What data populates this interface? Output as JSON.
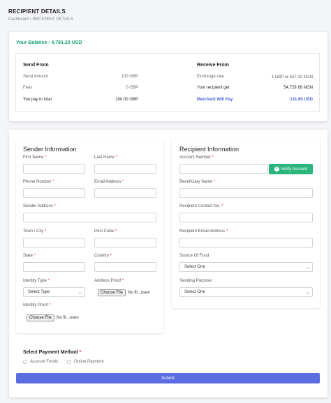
{
  "header": {
    "title": "RECIPIENT DETAILS",
    "breadcrumb": [
      "Dashboard",
      "RECIPIENT DETAILS"
    ],
    "breadcrumb_sep": "›"
  },
  "balance": "Your Balance : 4,791.20 USD",
  "send_from": {
    "title": "Send From",
    "rows": [
      {
        "label": "Send Amount",
        "value": "100 GBP"
      },
      {
        "label": "Fees",
        "value": "0 GBP"
      },
      {
        "label": "You pay in total",
        "value": "100.00 GBP"
      }
    ]
  },
  "receive_from": {
    "title": "Receive From",
    "rows": [
      {
        "label": "Exchange rate",
        "value": "1 GBP ⇄ 547.30 NGN"
      },
      {
        "label": "Your recipient get",
        "value": "54,729.66 NGN"
      },
      {
        "label": "Merchant Will Pay",
        "value": "131.60 USD"
      }
    ]
  },
  "sender": {
    "title": "Sender Information",
    "first_name": "First Name",
    "last_name": "Last Name",
    "phone": "Phone Number",
    "email": "Email Address",
    "address": "Sender Address",
    "town": "Town / City",
    "post_code": "Post Code",
    "state": "State",
    "country": "Country",
    "identity_type": "Identity Type",
    "identity_type_value": "Select Type",
    "address_proof": "Address Proof",
    "identity_proof": "Identity Proof",
    "file_button": "Choose File",
    "file_status": "No fil...osen"
  },
  "recipient": {
    "title": "Recipient Information",
    "account_number": "Account Number",
    "verify_button": "Verify Account",
    "beneficiary": "Beneficiary Name",
    "contact": "Recipient Contact No.",
    "email": "Recipient Email Address",
    "source_fund": "Source Of Fund",
    "source_fund_value": "Select One",
    "purpose": "Sending Purpose",
    "purpose_value": "Select One"
  },
  "payment": {
    "title": "Select Payment Method",
    "options": [
      "Account Funds",
      "Online Payment"
    ]
  },
  "submit": "Submit",
  "colors": {
    "accent": "#5b6ee1",
    "success": "#29b57c",
    "balance": "#1aa37a",
    "required": "#e03131"
  }
}
